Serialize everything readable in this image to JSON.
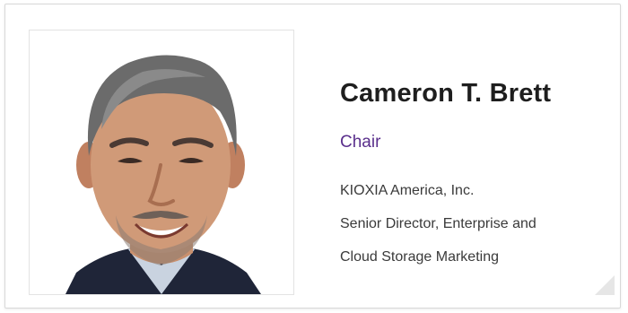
{
  "profile": {
    "name": "Cameron T. Brett",
    "role": "Chair",
    "company": "KIOXIA America, Inc.",
    "title_line1": "Senior Director, Enterprise and",
    "title_line2": "Cloud Storage Marketing"
  },
  "colors": {
    "role_accent": "#5a2f8c",
    "name_text": "#1e1e1e",
    "detail_text": "#3a3a3a",
    "card_border": "#d8d8d8"
  },
  "icons": {
    "photo": "person-portrait",
    "corner": "resize-corner-icon"
  }
}
